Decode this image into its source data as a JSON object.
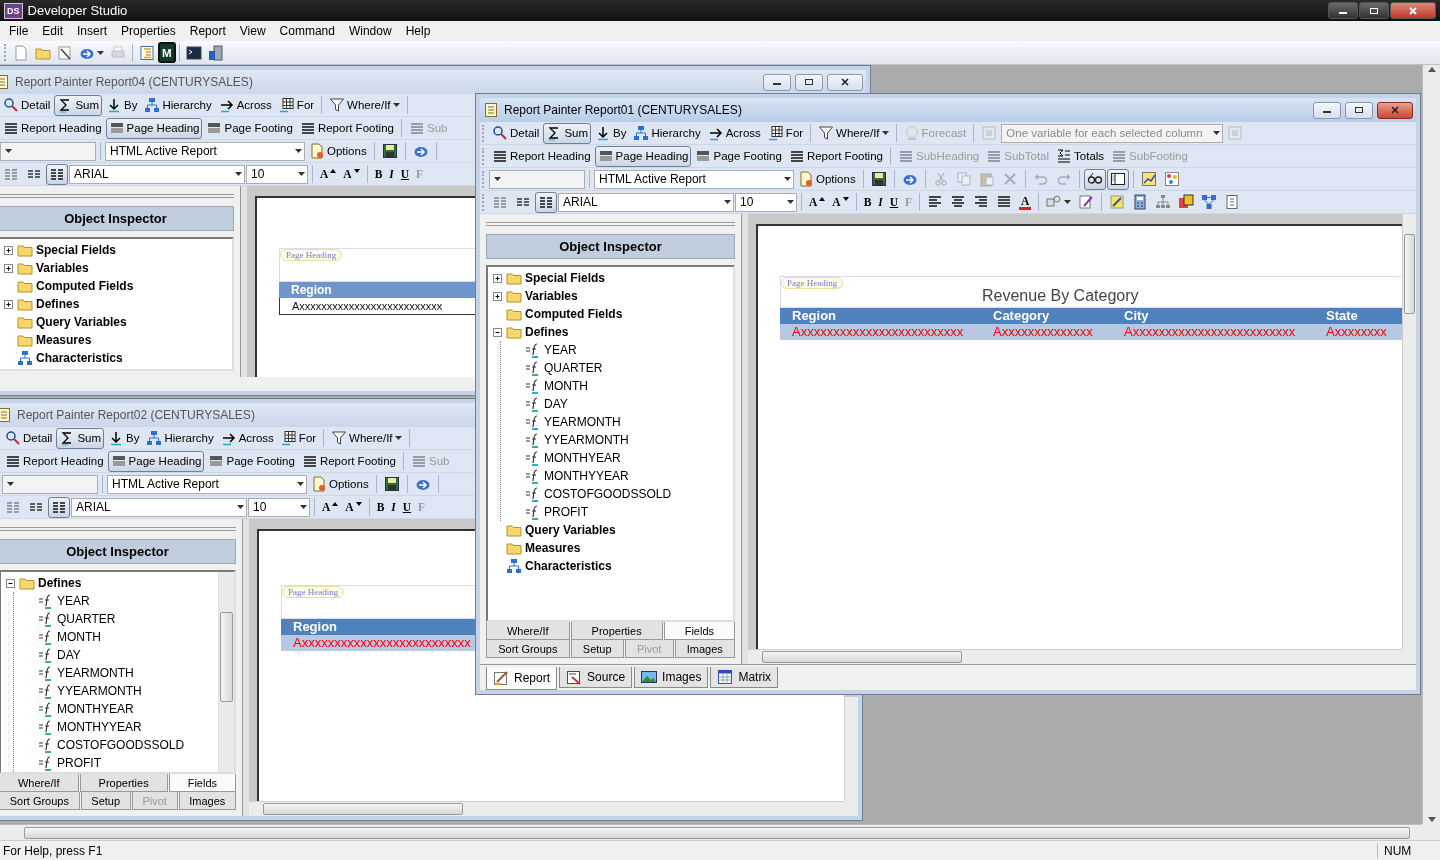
{
  "app": {
    "logo": "DS",
    "title": "Developer Studio"
  },
  "menu": [
    "File",
    "Edit",
    "Insert",
    "Properties",
    "Report",
    "View",
    "Command",
    "Window",
    "Help"
  ],
  "toolbar": [
    {
      "kind": "page",
      "selected": false,
      "disabled": false
    },
    {
      "kind": "folder",
      "selected": false,
      "disabled": false
    },
    {
      "kind": "wand",
      "selected": false,
      "disabled": false
    },
    {
      "kind": "arrowmenu",
      "selected": false,
      "disabled": false
    },
    {
      "kind": "printer",
      "selected": false,
      "disabled": true
    },
    {
      "kind": "sep"
    },
    {
      "kind": "outline",
      "selected": false,
      "disabled": false
    },
    {
      "kind": "mbox",
      "label": "M",
      "selected": false,
      "disabled": false
    },
    {
      "kind": "sep"
    },
    {
      "kind": "terminal",
      "selected": false,
      "disabled": false
    },
    {
      "kind": "server",
      "selected": false,
      "disabled": false
    }
  ],
  "windows": [
    {
      "title": "Report Painter Report04 (CENTURYSALES)",
      "active": false,
      "toolbars": [
        [
          {
            "kind": "magnifier",
            "label": "Detail",
            "selected": false,
            "disabled": false
          },
          {
            "kind": "sigma",
            "label": "Sum",
            "selected": true,
            "disabled": false
          },
          {
            "kind": "by",
            "label": "By",
            "selected": false,
            "disabled": false
          },
          {
            "kind": "hierarchy",
            "label": "Hierarchy",
            "selected": false,
            "disabled": false
          },
          {
            "kind": "across",
            "label": "Across",
            "selected": false,
            "disabled": false
          },
          {
            "kind": "grid",
            "label": "For",
            "selected": false,
            "disabled": false
          },
          {
            "kind": "sep"
          },
          {
            "kind": "funnelmenu",
            "label": "Where/If",
            "selected": false,
            "disabled": false
          },
          {
            "kind": "sep"
          }
        ],
        [
          {
            "kind": "lines",
            "label": "Report Heading",
            "selected": false,
            "disabled": false
          },
          {
            "kind": "band",
            "label": "Page Heading",
            "selected": true,
            "disabled": false
          },
          {
            "kind": "band",
            "label": "Page Footing",
            "selected": false,
            "disabled": false
          },
          {
            "kind": "lines",
            "label": "Report Footing",
            "selected": false,
            "disabled": false
          },
          {
            "kind": "sep"
          },
          {
            "kind": "lines",
            "label": "Sub",
            "selected": false,
            "disabled": true
          }
        ],
        [
          {
            "kind": "combo",
            "disabled": true
          },
          {
            "kind": "sep"
          },
          {
            "kind": "combo",
            "value": "HTML Active Report",
            "disabled": false
          },
          {
            "kind": "document",
            "label": "Options",
            "selected": false,
            "disabled": false
          },
          {
            "kind": "sep"
          },
          {
            "kind": "floppy",
            "selected": false,
            "disabled": false
          },
          {
            "kind": "sep"
          },
          {
            "kind": "arrow",
            "selected": false,
            "disabled": false
          },
          {
            "kind": "sep"
          }
        ],
        [
          {
            "kind": "cols1",
            "selected": false,
            "disabled": false
          },
          {
            "kind": "cols2",
            "selected": false,
            "disabled": false
          },
          {
            "kind": "cols3",
            "selected": true,
            "disabled": false
          },
          {
            "kind": "combo",
            "value": "ARIAL",
            "disabled": false
          },
          {
            "kind": "combo",
            "value": "10",
            "disabled": false
          },
          {
            "kind": "sep"
          },
          {
            "kind": "grow",
            "label": "A",
            "selected": false,
            "disabled": false
          },
          {
            "kind": "shrink",
            "label": "A",
            "selected": false,
            "disabled": false
          },
          {
            "kind": "sep"
          },
          {
            "kind": "bold",
            "label": "B",
            "selected": false,
            "disabled": false
          },
          {
            "kind": "italic",
            "label": "I",
            "selected": false,
            "disabled": false
          },
          {
            "kind": "underline",
            "label": "U",
            "selected": false,
            "disabled": false
          },
          {
            "kind": "serif",
            "label": "F",
            "selected": false,
            "disabled": true
          }
        ]
      ],
      "inspector": {
        "title": "Object Inspector",
        "scrollbar": false,
        "tree": [
          {
            "kind": "folder",
            "label": "Special Fields",
            "expanded": false
          },
          {
            "kind": "folder",
            "label": "Variables",
            "expanded": false
          },
          {
            "kind": "folder",
            "label": "Computed Fields"
          },
          {
            "kind": "folder",
            "label": "Defines",
            "expanded": false
          },
          {
            "kind": "folder",
            "label": "Query Variables"
          },
          {
            "kind": "folder",
            "label": "Measures"
          },
          {
            "kind": "hierarchy",
            "label": "Characteristics"
          }
        ]
      },
      "canvas": {
        "section_label": "Page Heading",
        "styled": false,
        "columns": [
          "Region"
        ],
        "row": [
          "Axxxxxxxxxxxxxxxxxxxxxxxxxx"
        ]
      }
    },
    {
      "title": "Report Painter Report02 (CENTURYSALES)",
      "active": false,
      "toolbars": [
        [
          {
            "kind": "magnifier",
            "label": "Detail",
            "selected": false,
            "disabled": false
          },
          {
            "kind": "sigma",
            "label": "Sum",
            "selected": true,
            "disabled": false
          },
          {
            "kind": "by",
            "label": "By",
            "selected": false,
            "disabled": false
          },
          {
            "kind": "hierarchy",
            "label": "Hierarchy",
            "selected": false,
            "disabled": false
          },
          {
            "kind": "across",
            "label": "Across",
            "selected": false,
            "disabled": false
          },
          {
            "kind": "grid",
            "label": "For",
            "selected": false,
            "disabled": false
          },
          {
            "kind": "sep"
          },
          {
            "kind": "funnelmenu",
            "label": "Where/If",
            "selected": false,
            "disabled": false
          },
          {
            "kind": "sep"
          }
        ],
        [
          {
            "kind": "lines",
            "label": "Report Heading",
            "selected": false,
            "disabled": false
          },
          {
            "kind": "band",
            "label": "Page Heading",
            "selected": true,
            "disabled": false
          },
          {
            "kind": "band",
            "label": "Page Footing",
            "selected": false,
            "disabled": false
          },
          {
            "kind": "lines",
            "label": "Report Footing",
            "selected": false,
            "disabled": false
          },
          {
            "kind": "sep"
          },
          {
            "kind": "lines",
            "label": "Sub",
            "selected": false,
            "disabled": true
          }
        ],
        [
          {
            "kind": "combo",
            "disabled": true
          },
          {
            "kind": "sep"
          },
          {
            "kind": "combo",
            "value": "HTML Active Report",
            "disabled": false
          },
          {
            "kind": "document",
            "label": "Options",
            "selected": false,
            "disabled": false
          },
          {
            "kind": "sep"
          },
          {
            "kind": "floppy",
            "selected": false,
            "disabled": false
          },
          {
            "kind": "sep"
          },
          {
            "kind": "arrow",
            "selected": false,
            "disabled": false
          },
          {
            "kind": "sep"
          }
        ],
        [
          {
            "kind": "cols1",
            "selected": false,
            "disabled": false
          },
          {
            "kind": "cols2",
            "selected": false,
            "disabled": false
          },
          {
            "kind": "cols3",
            "selected": true,
            "disabled": false
          },
          {
            "kind": "combo",
            "value": "ARIAL",
            "disabled": false
          },
          {
            "kind": "combo",
            "value": "10",
            "disabled": false
          },
          {
            "kind": "sep"
          },
          {
            "kind": "grow",
            "label": "A",
            "selected": false,
            "disabled": false
          },
          {
            "kind": "shrink",
            "label": "A",
            "selected": false,
            "disabled": false
          },
          {
            "kind": "sep"
          },
          {
            "kind": "bold",
            "label": "B",
            "selected": false,
            "disabled": false
          },
          {
            "kind": "italic",
            "label": "I",
            "selected": false,
            "disabled": false
          },
          {
            "kind": "underline",
            "label": "U",
            "selected": false,
            "disabled": false
          },
          {
            "kind": "serif",
            "label": "F",
            "selected": false,
            "disabled": true
          }
        ]
      ],
      "inspector": {
        "title": "Object Inspector",
        "scrollbar": true,
        "tree": [
          {
            "kind": "folder",
            "label": "Defines",
            "expanded": true,
            "children": [
              {
                "kind": "formula",
                "label": "YEAR"
              },
              {
                "kind": "formula",
                "label": "QUARTER"
              },
              {
                "kind": "formula",
                "label": "MONTH"
              },
              {
                "kind": "formula",
                "label": "DAY"
              },
              {
                "kind": "formula",
                "label": "YEARMONTH"
              },
              {
                "kind": "formula",
                "label": "YYEARMONTH"
              },
              {
                "kind": "formula",
                "label": "MONTHYEAR"
              },
              {
                "kind": "formula",
                "label": "MONTHYYEAR"
              },
              {
                "kind": "formula",
                "label": "COSTOFGOODSSOLD"
              },
              {
                "kind": "formula",
                "label": "PROFIT"
              }
            ]
          }
        ],
        "tabs": [
          [
            {
              "label": "Where/If",
              "selected": false,
              "disabled": false
            },
            {
              "label": "Properties",
              "selected": false,
              "disabled": false
            },
            {
              "label": "Fields",
              "selected": true,
              "disabled": false
            }
          ],
          [
            {
              "label": "Sort Groups",
              "selected": false,
              "disabled": false
            },
            {
              "label": "Setup",
              "selected": false,
              "disabled": false
            },
            {
              "label": "Pivot",
              "selected": false,
              "disabled": true
            },
            {
              "label": "Images",
              "selected": false,
              "disabled": false
            }
          ]
        ]
      },
      "canvas": {
        "section_label": "Page Heading",
        "styled": true,
        "columns": [
          "Region"
        ],
        "row": [
          "Axxxxxxxxxxxxxxxxxxxxxxxxxx"
        ]
      }
    },
    {
      "title": "Report Painter Report01 (CENTURYSALES)",
      "active": true,
      "toolbars": [
        [
          {
            "kind": "magnifier",
            "label": "Detail",
            "selected": false,
            "disabled": false
          },
          {
            "kind": "sigma",
            "label": "Sum",
            "selected": true,
            "disabled": false
          },
          {
            "kind": "by",
            "label": "By",
            "selected": false,
            "disabled": false
          },
          {
            "kind": "hierarchy",
            "label": "Hierarchy",
            "selected": false,
            "disabled": false
          },
          {
            "kind": "across",
            "label": "Across",
            "selected": false,
            "disabled": false
          },
          {
            "kind": "grid",
            "label": "For",
            "selected": false,
            "disabled": false
          },
          {
            "kind": "sep"
          },
          {
            "kind": "funnelmenu",
            "label": "Where/If",
            "selected": false,
            "disabled": false
          },
          {
            "kind": "sep"
          },
          {
            "kind": "globe",
            "label": "Forecast",
            "selected": false,
            "disabled": true
          },
          {
            "kind": "sep"
          },
          {
            "kind": "frame",
            "selected": false,
            "disabled": true
          },
          {
            "kind": "combo",
            "value": "One variable for each selected column",
            "disabled": true
          },
          {
            "kind": "frame",
            "selected": false,
            "disabled": true
          }
        ],
        [
          {
            "kind": "lines",
            "label": "Report Heading",
            "selected": false,
            "disabled": false
          },
          {
            "kind": "band",
            "label": "Page Heading",
            "selected": true,
            "disabled": false
          },
          {
            "kind": "band",
            "label": "Page Footing",
            "selected": false,
            "disabled": false
          },
          {
            "kind": "lines",
            "label": "Report Footing",
            "selected": false,
            "disabled": false
          },
          {
            "kind": "sep"
          },
          {
            "kind": "lines",
            "label": "SubHeading",
            "selected": false,
            "disabled": true
          },
          {
            "kind": "lines",
            "label": "SubTotal",
            "selected": false,
            "disabled": true
          },
          {
            "kind": "totals",
            "label": "Totals",
            "selected": false,
            "disabled": false
          },
          {
            "kind": "lines",
            "label": "SubFooting",
            "selected": false,
            "disabled": true
          }
        ],
        [
          {
            "kind": "combo",
            "disabled": true
          },
          {
            "kind": "sep"
          },
          {
            "kind": "combo",
            "value": "HTML Active Report",
            "disabled": false
          },
          {
            "kind": "document",
            "label": "Options",
            "selected": false,
            "disabled": false
          },
          {
            "kind": "sep"
          },
          {
            "kind": "floppy",
            "selected": false,
            "disabled": false
          },
          {
            "kind": "sep"
          },
          {
            "kind": "arrow",
            "selected": false,
            "disabled": false
          },
          {
            "kind": "sep"
          },
          {
            "kind": "scissors",
            "selected": false,
            "disabled": true
          },
          {
            "kind": "copy",
            "selected": false,
            "disabled": true
          },
          {
            "kind": "paste",
            "selected": false,
            "disabled": true
          },
          {
            "kind": "delete",
            "selected": false,
            "disabled": true
          },
          {
            "kind": "sep"
          },
          {
            "kind": "undo",
            "selected": false,
            "disabled": true
          },
          {
            "kind": "redo",
            "selected": false,
            "disabled": true
          },
          {
            "kind": "sep"
          },
          {
            "kind": "glasses",
            "selected": true,
            "disabled": false
          },
          {
            "kind": "panel",
            "selected": true,
            "disabled": false
          },
          {
            "kind": "sep"
          },
          {
            "kind": "chart",
            "selected": false,
            "disabled": false
          },
          {
            "kind": "palette",
            "selected": false,
            "disabled": false
          }
        ],
        [
          {
            "kind": "cols1",
            "selected": false,
            "disabled": false
          },
          {
            "kind": "cols2",
            "selected": false,
            "disabled": false
          },
          {
            "kind": "cols3",
            "selected": true,
            "disabled": false
          },
          {
            "kind": "combo",
            "value": "ARIAL",
            "disabled": false
          },
          {
            "kind": "combo",
            "value": "10",
            "disabled": false
          },
          {
            "kind": "sep"
          },
          {
            "kind": "grow",
            "label": "A",
            "selected": false,
            "disabled": false
          },
          {
            "kind": "shrink",
            "label": "A",
            "selected": false,
            "disabled": false
          },
          {
            "kind": "sep"
          },
          {
            "kind": "bold",
            "label": "B",
            "selected": false,
            "disabled": false
          },
          {
            "kind": "italic",
            "label": "I",
            "selected": false,
            "disabled": false
          },
          {
            "kind": "underline",
            "label": "U",
            "selected": false,
            "disabled": false
          },
          {
            "kind": "serif",
            "label": "F",
            "selected": false,
            "disabled": true
          },
          {
            "kind": "sep"
          },
          {
            "kind": "alignl",
            "selected": false,
            "disabled": false
          },
          {
            "kind": "alignc",
            "selected": false,
            "disabled": false
          },
          {
            "kind": "alignr",
            "selected": false,
            "disabled": false
          },
          {
            "kind": "justify",
            "selected": false,
            "disabled": false
          },
          {
            "kind": "fontcolor",
            "label": "A",
            "selected": false,
            "disabled": false
          },
          {
            "kind": "sep"
          },
          {
            "kind": "shapesmenu",
            "selected": false,
            "disabled": false
          },
          {
            "kind": "brush",
            "selected": false,
            "disabled": false
          },
          {
            "kind": "sep"
          },
          {
            "kind": "pen",
            "selected": false,
            "disabled": false
          },
          {
            "kind": "calculator",
            "selected": false,
            "disabled": false
          },
          {
            "kind": "treediag",
            "selected": false,
            "disabled": false
          },
          {
            "kind": "stack",
            "selected": false,
            "disabled": false
          },
          {
            "kind": "network",
            "selected": false,
            "disabled": false
          },
          {
            "kind": "note",
            "selected": false,
            "disabled": false
          }
        ]
      ],
      "inspector": {
        "title": "Object Inspector",
        "scrollbar": false,
        "tree": [
          {
            "kind": "folder",
            "label": "Special Fields",
            "expanded": false
          },
          {
            "kind": "folder",
            "label": "Variables",
            "expanded": false
          },
          {
            "kind": "folder",
            "label": "Computed Fields"
          },
          {
            "kind": "folder",
            "label": "Defines",
            "expanded": true,
            "children": [
              {
                "kind": "formula",
                "label": "YEAR"
              },
              {
                "kind": "formula",
                "label": "QUARTER"
              },
              {
                "kind": "formula",
                "label": "MONTH"
              },
              {
                "kind": "formula",
                "label": "DAY"
              },
              {
                "kind": "formula",
                "label": "YEARMONTH"
              },
              {
                "kind": "formula",
                "label": "YYEARMONTH"
              },
              {
                "kind": "formula",
                "label": "MONTHYEAR"
              },
              {
                "kind": "formula",
                "label": "MONTHYYEAR"
              },
              {
                "kind": "formula",
                "label": "COSTOFGOODSSOLD"
              },
              {
                "kind": "formula",
                "label": "PROFIT"
              }
            ]
          },
          {
            "kind": "folder",
            "label": "Query Variables"
          },
          {
            "kind": "folder",
            "label": "Measures"
          },
          {
            "kind": "hierarchy",
            "label": "Characteristics"
          }
        ],
        "tabs": [
          [
            {
              "label": "Where/If",
              "selected": false,
              "disabled": false
            },
            {
              "label": "Properties",
              "selected": false,
              "disabled": false
            },
            {
              "label": "Fields",
              "selected": true,
              "disabled": false
            }
          ],
          [
            {
              "label": "Sort Groups",
              "selected": false,
              "disabled": false
            },
            {
              "label": "Setup",
              "selected": false,
              "disabled": false
            },
            {
              "label": "Pivot",
              "selected": false,
              "disabled": true
            },
            {
              "label": "Images",
              "selected": false,
              "disabled": false
            }
          ]
        ]
      },
      "canvas": {
        "section_label": "Page Heading",
        "title": "Revenue By Category",
        "styled": true,
        "columns": [
          "Region",
          "Category",
          "City",
          "State"
        ],
        "row": [
          "Axxxxxxxxxxxxxxxxxxxxxxxxx",
          "Axxxxxxxxxxxxxx",
          "Axxxxxxxxxxxxxxxxxxxxxxxxx",
          "Axxxxxxxx"
        ]
      },
      "view_tabs": [
        {
          "kind": "pencilpage",
          "label": "Report",
          "selected": true
        },
        {
          "kind": "source",
          "label": "Source",
          "selected": false
        },
        {
          "kind": "landscape",
          "label": "Images",
          "selected": false
        },
        {
          "kind": "table",
          "label": "Matrix",
          "selected": false
        }
      ]
    }
  ],
  "status_bar": {
    "text": "For Help, press F1",
    "indicator": "NUM"
  }
}
